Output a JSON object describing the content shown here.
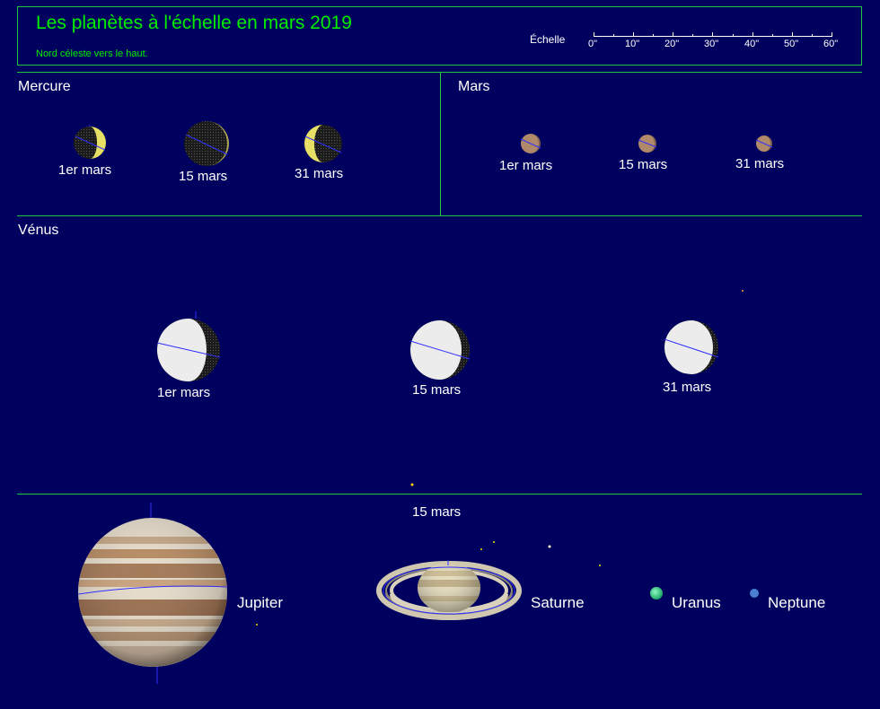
{
  "header": {
    "title": "Les planètes à l'échelle en mars 2019",
    "subtitle": "Nord céleste vers le haut.",
    "scale_label": "Échelle",
    "scale_ticks": [
      "0\"",
      "10\"",
      "20\"",
      "30\"",
      "40\"",
      "50\"",
      "60\""
    ]
  },
  "mercure": {
    "title": "Mercure",
    "dates": [
      "1er mars",
      "15 mars",
      "31 mars"
    ]
  },
  "mars": {
    "title": "Mars",
    "dates": [
      "1er mars",
      "15 mars",
      "31 mars"
    ]
  },
  "venus": {
    "title": "Vénus",
    "dates": [
      "1er mars",
      "15 mars",
      "31 mars"
    ]
  },
  "outer": {
    "date": "15 mars",
    "jupiter": "Jupiter",
    "saturne": "Saturne",
    "uranus": "Uranus",
    "neptune": "Neptune"
  },
  "colors": {
    "background": "#00005e",
    "frame": "#21c83c",
    "title": "#00ee00",
    "text": "#ffffff",
    "mercury_lit": "#e8e066",
    "venus_lit": "#ececec",
    "mars_disk": "#b0886a",
    "uranus": "#3ddc84",
    "neptune": "#4a7fd0"
  }
}
